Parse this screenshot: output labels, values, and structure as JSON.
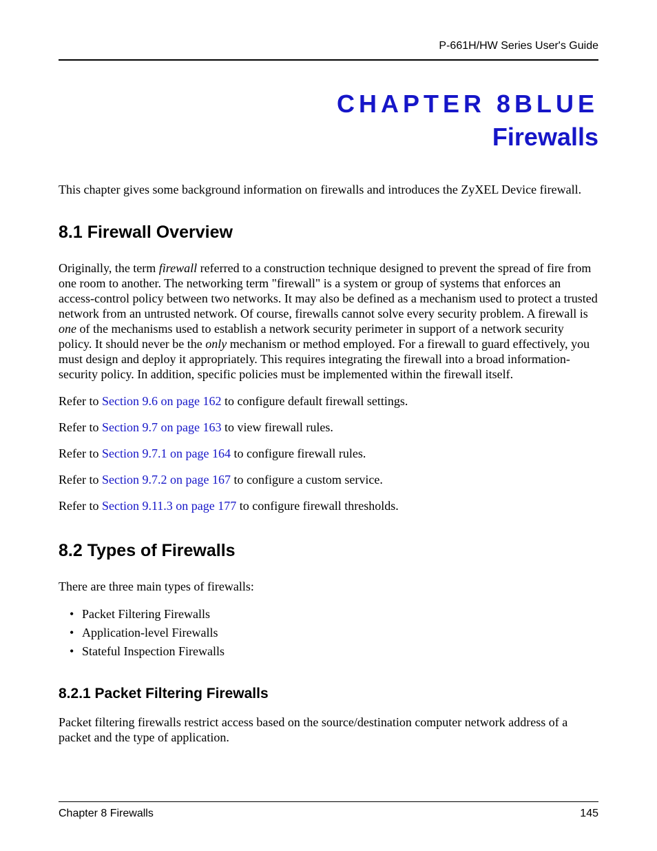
{
  "header": {
    "guide_title": "P-661H/HW Series User's Guide"
  },
  "chapter": {
    "label_prefix": "CHAPTER ",
    "number": "8",
    "label_suffix": "BLUE",
    "title": "Firewalls"
  },
  "intro": "This chapter gives some background information on firewalls and introduces the ZyXEL Device firewall.",
  "sec81": {
    "heading": "8.1  Firewall Overview",
    "p1_a": "Originally, the term ",
    "p1_em1": "firewall",
    "p1_b": " referred to a construction technique designed to prevent the spread of fire from one room to another. The networking term \"firewall\" is a system or group of systems that enforces an access-control policy between two networks. It may also be defined as a mechanism used to protect a trusted network from an untrusted network. Of course, firewalls cannot solve every security problem. A firewall is ",
    "p1_em2": "one",
    "p1_c": " of the mechanisms used to establish a network security perimeter in support of a network security policy. It should never be the ",
    "p1_em3": "only",
    "p1_d": " mechanism or method employed. For a firewall to guard effectively, you must design and deploy it appropriately. This requires integrating the firewall into a broad information-security policy. In addition, specific policies must be implemented within the firewall itself.",
    "ref1_a": "Refer to ",
    "ref1_link": "Section 9.6 on page 162",
    "ref1_b": " to configure default firewall settings.",
    "ref2_a": "Refer to ",
    "ref2_link": "Section 9.7 on page 163",
    "ref2_b": " to view firewall rules.",
    "ref3_a": "Refer to ",
    "ref3_link": "Section 9.7.1 on page 164",
    "ref3_b": " to configure firewall rules.",
    "ref4_a": "Refer to ",
    "ref4_link": "Section 9.7.2 on page 167",
    "ref4_b": " to configure a custom service.",
    "ref5_a": "Refer to ",
    "ref5_link": "Section 9.11.3 on page 177",
    "ref5_b": " to configure firewall thresholds."
  },
  "sec82": {
    "heading": "8.2  Types of Firewalls",
    "intro": "There are three main types of firewalls:",
    "bullets": {
      "b1": "Packet Filtering Firewalls",
      "b2": "Application-level Firewalls",
      "b3": "Stateful Inspection Firewalls"
    }
  },
  "sec821": {
    "heading": "8.2.1  Packet Filtering Firewalls",
    "p1": "Packet filtering firewalls restrict access based on the source/destination computer network address of a packet and the type of application."
  },
  "footer": {
    "left": "Chapter 8 Firewalls",
    "right": "145"
  }
}
